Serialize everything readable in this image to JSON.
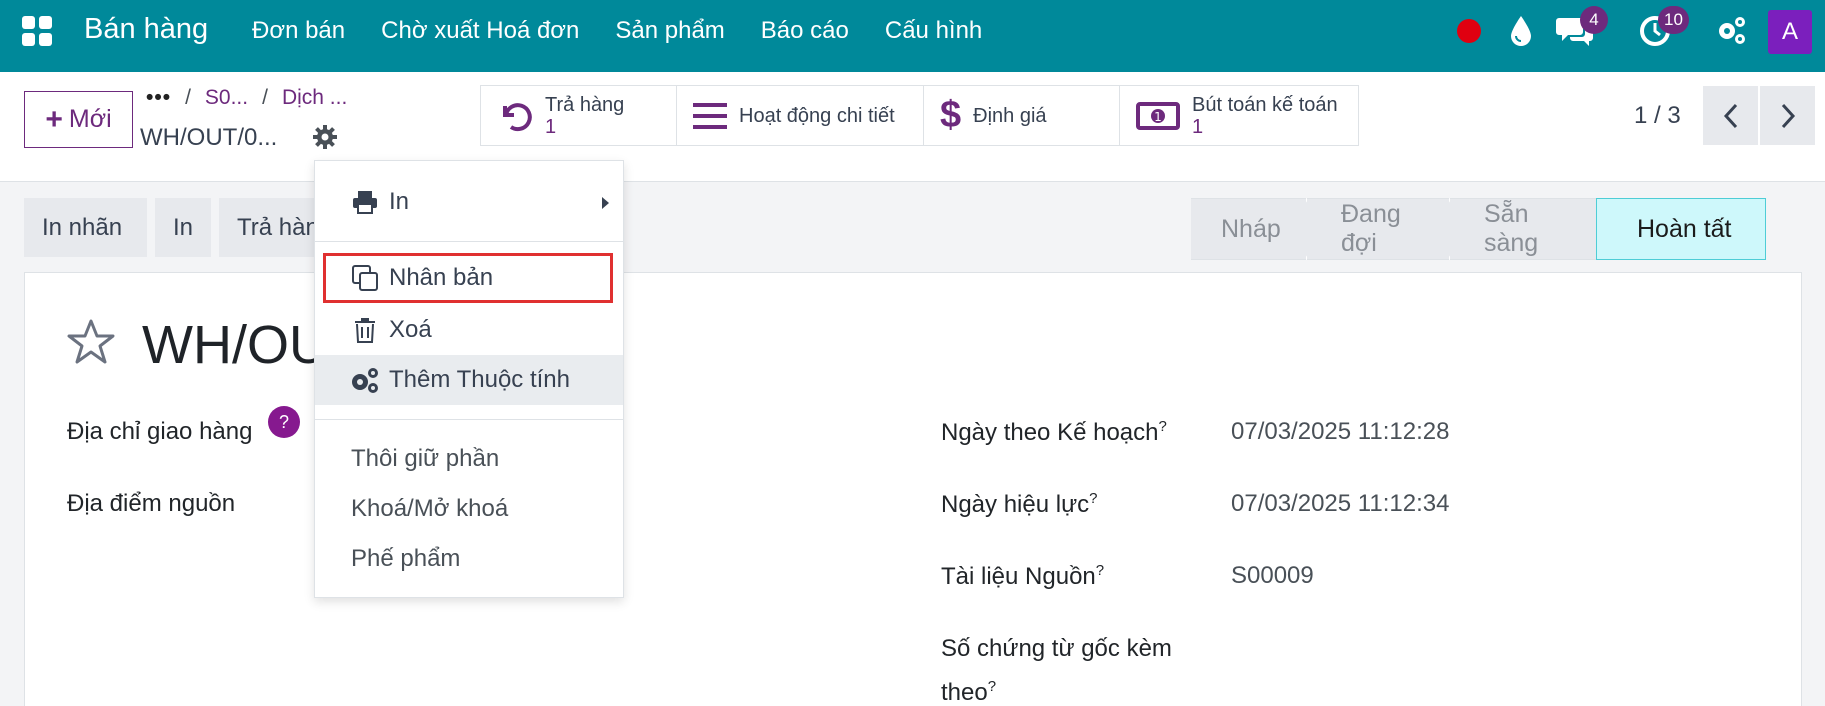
{
  "nav": {
    "app_name": "Bán hàng",
    "menu": [
      "Đơn bán",
      "Chờ xuất Hoá đơn",
      "Sản phẩm",
      "Báo cáo",
      "Cấu hình"
    ],
    "chat_badge": "4",
    "activity_badge": "10",
    "avatar_letter": "A",
    "brand_color": "#00899a"
  },
  "control": {
    "new_button": "Mới",
    "breadcrumb": [
      "•••",
      "S0...",
      "Dịch ..."
    ],
    "record_name": "WH/OUT/0...",
    "smart_buttons": [
      {
        "label": "Trả hàng",
        "count": "1",
        "icon": "undo-icon"
      },
      {
        "label": "Hoạt động chi tiết",
        "count": "",
        "icon": "list-icon"
      },
      {
        "label": "Định giá",
        "count": "",
        "icon": "dollar-icon"
      },
      {
        "label": "Bút toán kế toán",
        "count": "1",
        "icon": "money-icon"
      }
    ],
    "pager": "1 / 3"
  },
  "actions": {
    "print_label": "In nhãn",
    "print": "In",
    "return": "Trả hàn"
  },
  "status": {
    "stages": [
      "Nháp",
      "Đang đợi",
      "Sẵn sàng",
      "Hoàn tất"
    ],
    "active": "Hoàn tất"
  },
  "sheet": {
    "title": "WH/OUT",
    "left_fields": [
      "Địa chỉ giao hàng",
      "Địa điểm nguồn"
    ],
    "right_fields": [
      {
        "label": "Ngày theo Kế hoạch",
        "value": "07/03/2025 11:12:28"
      },
      {
        "label": "Ngày hiệu lực",
        "value": "07/03/2025 11:12:34"
      },
      {
        "label": "Tài liệu Nguồn",
        "value": "S00009"
      },
      {
        "label": "Số chứng từ gốc kèm theo",
        "value": ""
      }
    ],
    "help_mark": "?"
  },
  "dropdown": {
    "print": "In",
    "duplicate": "Nhân bản",
    "delete": "Xoá",
    "add_property": "Thêm Thuộc tính",
    "unreserve": "Thôi giữ phần",
    "lock_unlock": "Khoá/Mở khoá",
    "scrap": "Phế phẩm"
  }
}
